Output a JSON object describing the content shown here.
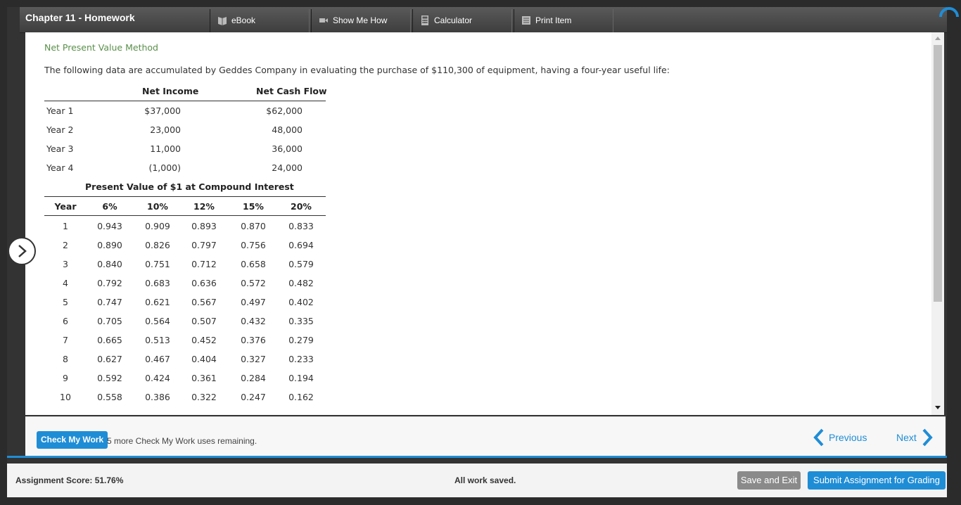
{
  "header": {
    "title": "Chapter 11 - Homework",
    "tabs": [
      {
        "label": "eBook",
        "icon": "book-icon"
      },
      {
        "label": "Show Me How",
        "icon": "video-icon"
      },
      {
        "label": "Calculator",
        "icon": "calculator-icon"
      },
      {
        "label": "Print Item",
        "icon": "print-icon"
      }
    ]
  },
  "question": {
    "title": "Net Present Value Method",
    "intro": "The following data are accumulated by Geddes Company in evaluating the purchase of $110,300 of equipment, having a four-year useful life:"
  },
  "cash_table": {
    "headers": [
      "Net Income",
      "Net Cash Flow"
    ],
    "rows": [
      {
        "label": "Year 1",
        "income": "$37,000",
        "cash": "$62,000"
      },
      {
        "label": "Year 2",
        "income": "23,000",
        "cash": "48,000"
      },
      {
        "label": "Year 3",
        "income": "11,000",
        "cash": "36,000"
      },
      {
        "label": "Year 4",
        "income": "(1,000)",
        "cash": "24,000"
      }
    ]
  },
  "pv_table": {
    "title": "Present Value of $1 at Compound Interest",
    "headers": [
      "Year",
      "6%",
      "10%",
      "12%",
      "15%",
      "20%"
    ],
    "rows": [
      [
        "1",
        "0.943",
        "0.909",
        "0.893",
        "0.870",
        "0.833"
      ],
      [
        "2",
        "0.890",
        "0.826",
        "0.797",
        "0.756",
        "0.694"
      ],
      [
        "3",
        "0.840",
        "0.751",
        "0.712",
        "0.658",
        "0.579"
      ],
      [
        "4",
        "0.792",
        "0.683",
        "0.636",
        "0.572",
        "0.482"
      ],
      [
        "5",
        "0.747",
        "0.621",
        "0.567",
        "0.497",
        "0.402"
      ],
      [
        "6",
        "0.705",
        "0.564",
        "0.507",
        "0.432",
        "0.335"
      ],
      [
        "7",
        "0.665",
        "0.513",
        "0.452",
        "0.376",
        "0.279"
      ],
      [
        "8",
        "0.627",
        "0.467",
        "0.404",
        "0.327",
        "0.233"
      ],
      [
        "9",
        "0.592",
        "0.424",
        "0.361",
        "0.284",
        "0.194"
      ],
      [
        "10",
        "0.558",
        "0.386",
        "0.322",
        "0.247",
        "0.162"
      ]
    ]
  },
  "actions": {
    "check_label": "Check My Work",
    "check_note": "5 more Check My Work uses remaining.",
    "previous_label": "Previous",
    "next_label": "Next"
  },
  "footer": {
    "score": "Assignment Score: 51.76%",
    "saved": "All work saved.",
    "save_exit_label": "Save and Exit",
    "submit_label": "Submit Assignment for Grading"
  },
  "colors": {
    "accent": "#1f8dd6",
    "title_green": "#5a8f4a"
  }
}
